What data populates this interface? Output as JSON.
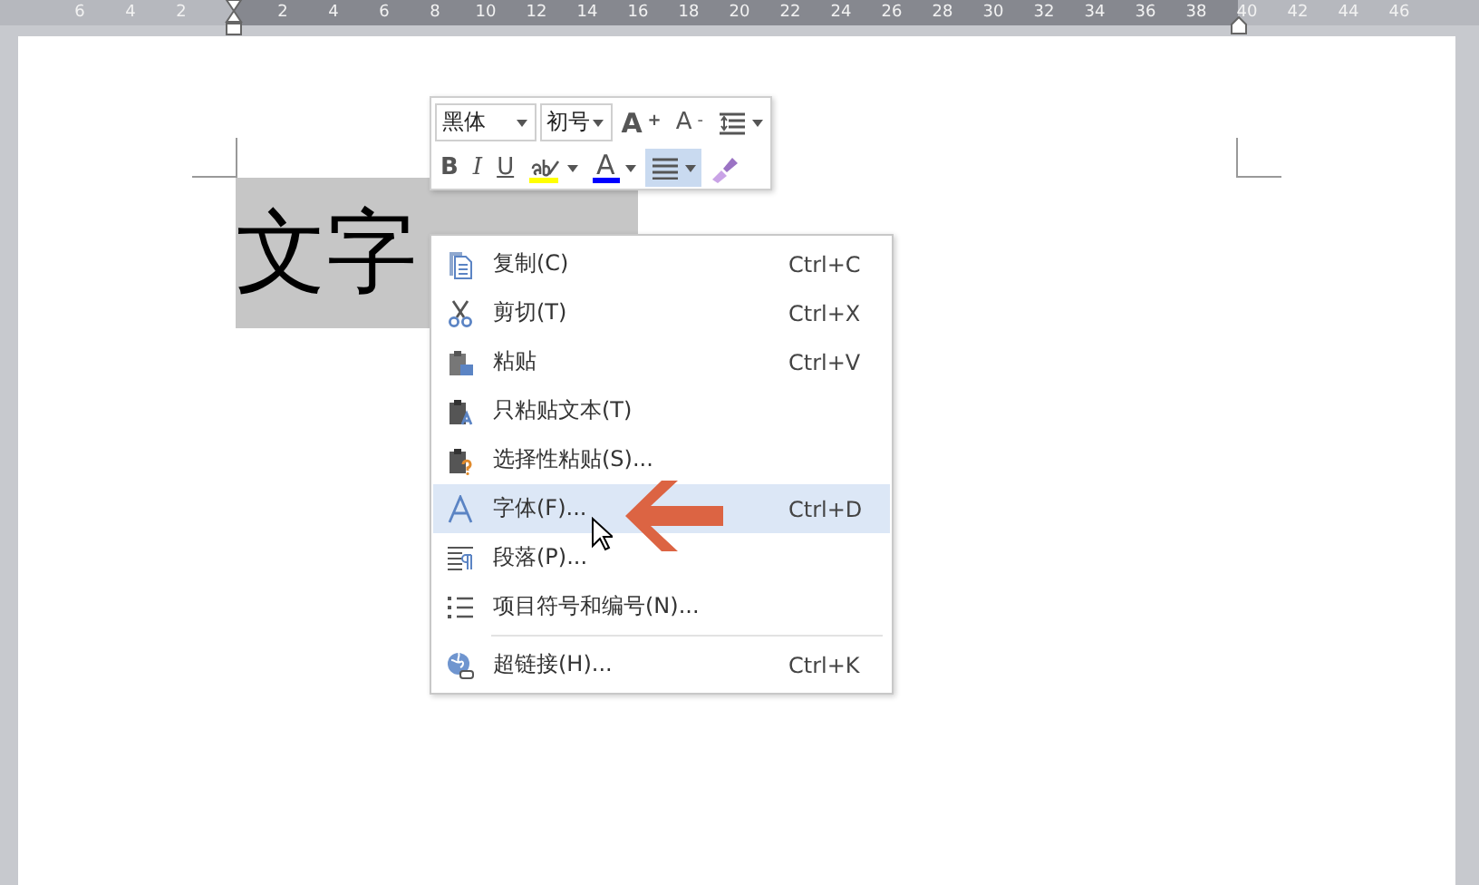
{
  "ruler": {
    "left_numbers": [
      "6",
      "4",
      "2"
    ],
    "right_numbers": [
      "2",
      "4",
      "6",
      "8",
      "10",
      "12",
      "14",
      "16",
      "18",
      "20",
      "22",
      "24",
      "26",
      "28",
      "30",
      "32",
      "34",
      "36",
      "38",
      "40",
      "42",
      "44",
      "46"
    ]
  },
  "document": {
    "text": "文字",
    "selected": true
  },
  "toolbar": {
    "font": "黑体",
    "size": "初号",
    "buttons": [
      {
        "kind": "grow",
        "label": "A$^{+}$",
        "selected": false
      },
      {
        "kind": "shrink",
        "label": "A$^{-}$",
        "selected": false
      },
      {
        "kind": "spacing",
        "selected": false
      },
      {
        "kind": "bold",
        "label": "B",
        "selected": false
      },
      {
        "kind": "italic",
        "label": "I",
        "selected": false
      },
      {
        "kind": "underline",
        "label": "U",
        "selected": false
      },
      {
        "kind": "highlight",
        "color": "#ffff00",
        "selected": false
      },
      {
        "kind": "fontcolor",
        "label": "A",
        "color": "#0000ff",
        "selected": false
      },
      {
        "kind": "align",
        "selected": true
      },
      {
        "kind": "painter",
        "selected": false
      }
    ]
  },
  "context_menu": {
    "items": [
      {
        "label": "复制(C)",
        "shortcut": "Ctrl+C",
        "selected": false,
        "separated": false
      },
      {
        "label": "剪切(T)",
        "shortcut": "Ctrl+X",
        "selected": false,
        "separated": false
      },
      {
        "label": "粘贴",
        "shortcut": "Ctrl+V",
        "selected": false,
        "separated": false
      },
      {
        "label": "只粘贴文本(T)",
        "selected": false,
        "separated": false
      },
      {
        "label": "选择性粘贴(S)...",
        "selected": false,
        "separated": false
      },
      {
        "label": "字体(F)...",
        "shortcut": "Ctrl+D",
        "selected": true,
        "separated": false
      },
      {
        "label": "段落(P)...",
        "selected": false,
        "separated": false
      },
      {
        "label": "项目符号和编号(N)...",
        "selected": false,
        "separated": false
      },
      {
        "label": "超链接(H)...",
        "shortcut": "Ctrl+K",
        "selected": false,
        "separated": true
      }
    ]
  }
}
